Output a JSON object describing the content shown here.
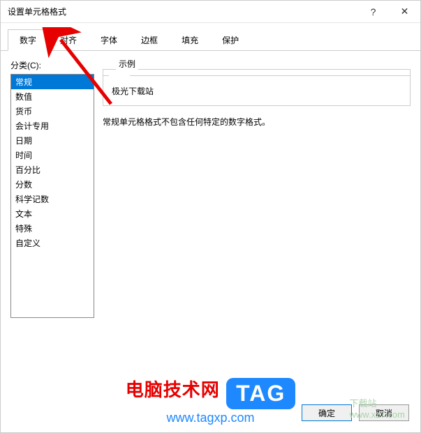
{
  "window": {
    "title": "设置单元格格式",
    "help_symbol": "?",
    "close_symbol": "✕"
  },
  "tabs": {
    "number": "数字",
    "alignment": "对齐",
    "font": "字体",
    "border": "边框",
    "fill": "填充",
    "protection": "保护"
  },
  "category": {
    "label": "分类(C):",
    "items": [
      "常规",
      "数值",
      "货币",
      "会计专用",
      "日期",
      "时间",
      "百分比",
      "分数",
      "科学记数",
      "文本",
      "特殊",
      "自定义"
    ]
  },
  "sample": {
    "label": "示例",
    "value": "极光下载站"
  },
  "description": "常规单元格格式不包含任何特定的数字格式。",
  "footer": {
    "ok": "确定",
    "cancel": "取消"
  },
  "watermark": {
    "title": "电脑技术网",
    "tag": "TAG",
    "sub": "www.tagxp.com",
    "ghost_top": "下载站",
    "ghost_bottom": "www.xz7.com"
  }
}
